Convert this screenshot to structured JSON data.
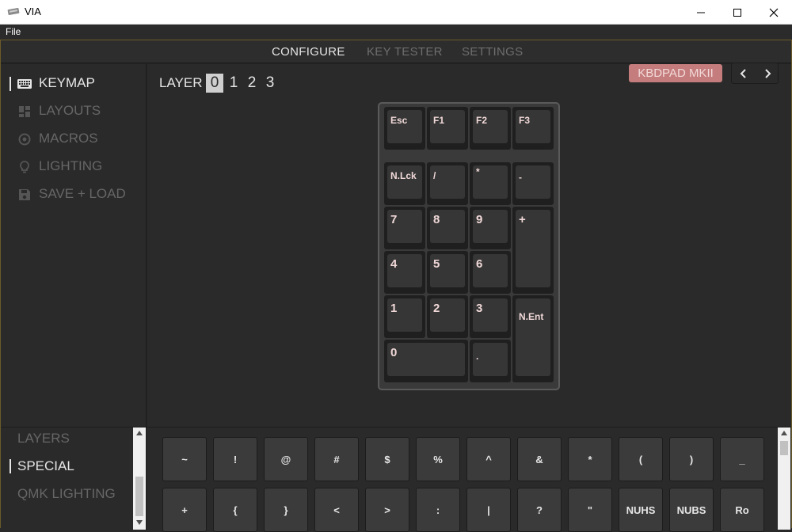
{
  "window": {
    "title": "VIA",
    "controls": {
      "minimize_icon": "minimize-icon",
      "maximize_icon": "maximize-icon",
      "close_icon": "close-icon"
    }
  },
  "menubar": {
    "file": "File"
  },
  "topnav": {
    "tabs": [
      {
        "label": "CONFIGURE",
        "active": true
      },
      {
        "label": "KEY TESTER",
        "active": false
      },
      {
        "label": "SETTINGS",
        "active": false
      }
    ]
  },
  "sidebar": {
    "items": [
      {
        "label": "KEYMAP",
        "icon": "keyboard-icon",
        "active": true
      },
      {
        "label": "LAYOUTS",
        "icon": "dashboard-icon",
        "active": false
      },
      {
        "label": "MACROS",
        "icon": "circle-dot-icon",
        "active": false
      },
      {
        "label": "LIGHTING",
        "icon": "lightbulb-icon",
        "active": false
      },
      {
        "label": "SAVE + LOAD",
        "icon": "floppy-disk-icon",
        "active": false
      }
    ]
  },
  "main": {
    "layer_label": "LAYER",
    "layers": [
      "0",
      "1",
      "2",
      "3"
    ],
    "active_layer": "0",
    "keyboard_name": "KBDPAD MKII",
    "prev_icon": "chevron-left-icon",
    "next_icon": "chevron-right-icon",
    "keys": {
      "esc": "Esc",
      "f1": "F1",
      "f2": "F2",
      "f3": "F3",
      "nlck": "N.Lck",
      "slash": "/",
      "star": "*",
      "minus": "-",
      "k7": "7",
      "k8": "8",
      "k9": "9",
      "plus": "+",
      "k4": "4",
      "k5": "5",
      "k6": "6",
      "k1": "1",
      "k2": "2",
      "k3": "3",
      "nent": "N.Ent",
      "k0": "0",
      "dot": "."
    }
  },
  "bottom": {
    "categories": [
      {
        "label": "LAYERS",
        "active": false
      },
      {
        "label": "SPECIAL",
        "active": true
      },
      {
        "label": "QMK LIGHTING",
        "active": false
      }
    ],
    "keys_row1": [
      "~",
      "!",
      "@",
      "#",
      "$",
      "%",
      "^",
      "&",
      "*",
      "(",
      ")",
      "_"
    ],
    "keys_row2": [
      "+",
      "{",
      "}",
      "<",
      ">",
      ":",
      "|",
      "?",
      "\"",
      "NUHS",
      "NUBS",
      "Ro"
    ]
  },
  "colors": {
    "accent_badge": "#c47c7c",
    "key_legend": "#f1d8d8",
    "active_text": "#e6e6e6",
    "inactive_text": "#666666",
    "window_border": "#6b5a2a"
  }
}
